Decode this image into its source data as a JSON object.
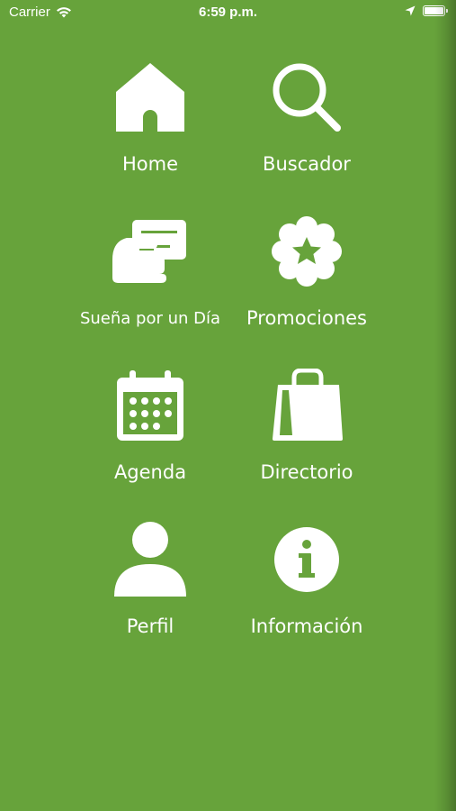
{
  "status_bar": {
    "carrier": "Carrier",
    "time": "6:59 p.m."
  },
  "menu": {
    "items": [
      {
        "label": "Home",
        "icon": "home-icon"
      },
      {
        "label": "Buscador",
        "icon": "search-icon"
      },
      {
        "label": "Sueña por un Día",
        "icon": "card-hand-icon"
      },
      {
        "label": "Promociones",
        "icon": "star-badge-icon"
      },
      {
        "label": "Agenda",
        "icon": "calendar-icon"
      },
      {
        "label": "Directorio",
        "icon": "shopping-bag-icon"
      },
      {
        "label": "Perfil",
        "icon": "user-icon"
      },
      {
        "label": "Información",
        "icon": "info-icon"
      }
    ]
  },
  "colors": {
    "background": "#67a33b",
    "foreground": "#ffffff"
  }
}
